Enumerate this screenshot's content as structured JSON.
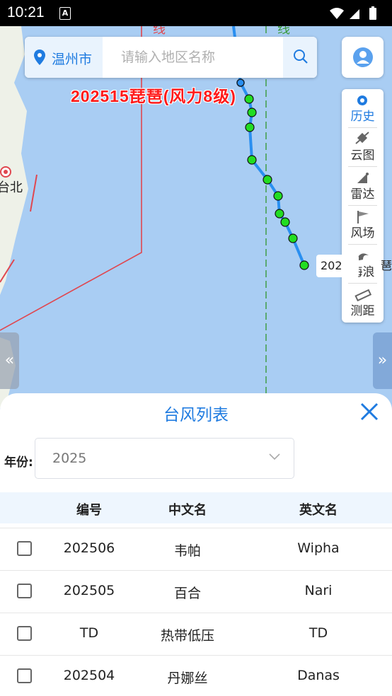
{
  "status_bar": {
    "time": "10:21",
    "notification_icon": "A"
  },
  "search": {
    "city": "温州市",
    "placeholder": "请输入地区名称"
  },
  "typhoon_title": "202515琵琶(风力8级)",
  "map": {
    "place_label": "台北",
    "line_label_red": "线",
    "line_label_green": "线",
    "track_label": "202",
    "track_label_right": "琶"
  },
  "tools": [
    {
      "icon": "history-icon",
      "label": "历史"
    },
    {
      "icon": "satellite-icon",
      "label": "云图"
    },
    {
      "icon": "radar-icon",
      "label": "雷达"
    },
    {
      "icon": "wind-flag-icon",
      "label": "风场"
    },
    {
      "icon": "wave-icon",
      "label": "海浪"
    },
    {
      "icon": "ruler-icon",
      "label": "测距"
    }
  ],
  "panel": {
    "title": "台风列表",
    "year_label": "年份:",
    "year_value": "2025",
    "columns": [
      "编号",
      "中文名",
      "英文名"
    ],
    "rows": [
      {
        "id": "202506",
        "cn": "韦帕",
        "en": "Wipha"
      },
      {
        "id": "202505",
        "cn": "百合",
        "en": "Nari"
      },
      {
        "id": "TD",
        "cn": "热带低压",
        "en": "TD"
      },
      {
        "id": "202504",
        "cn": "丹娜丝",
        "en": "Danas"
      }
    ]
  },
  "colors": {
    "accent": "#1f7be0",
    "track_point": "#22dd22",
    "warning_red": "#ff1a1a",
    "sea": "#a9cdf3",
    "land": "#eef1e8"
  }
}
